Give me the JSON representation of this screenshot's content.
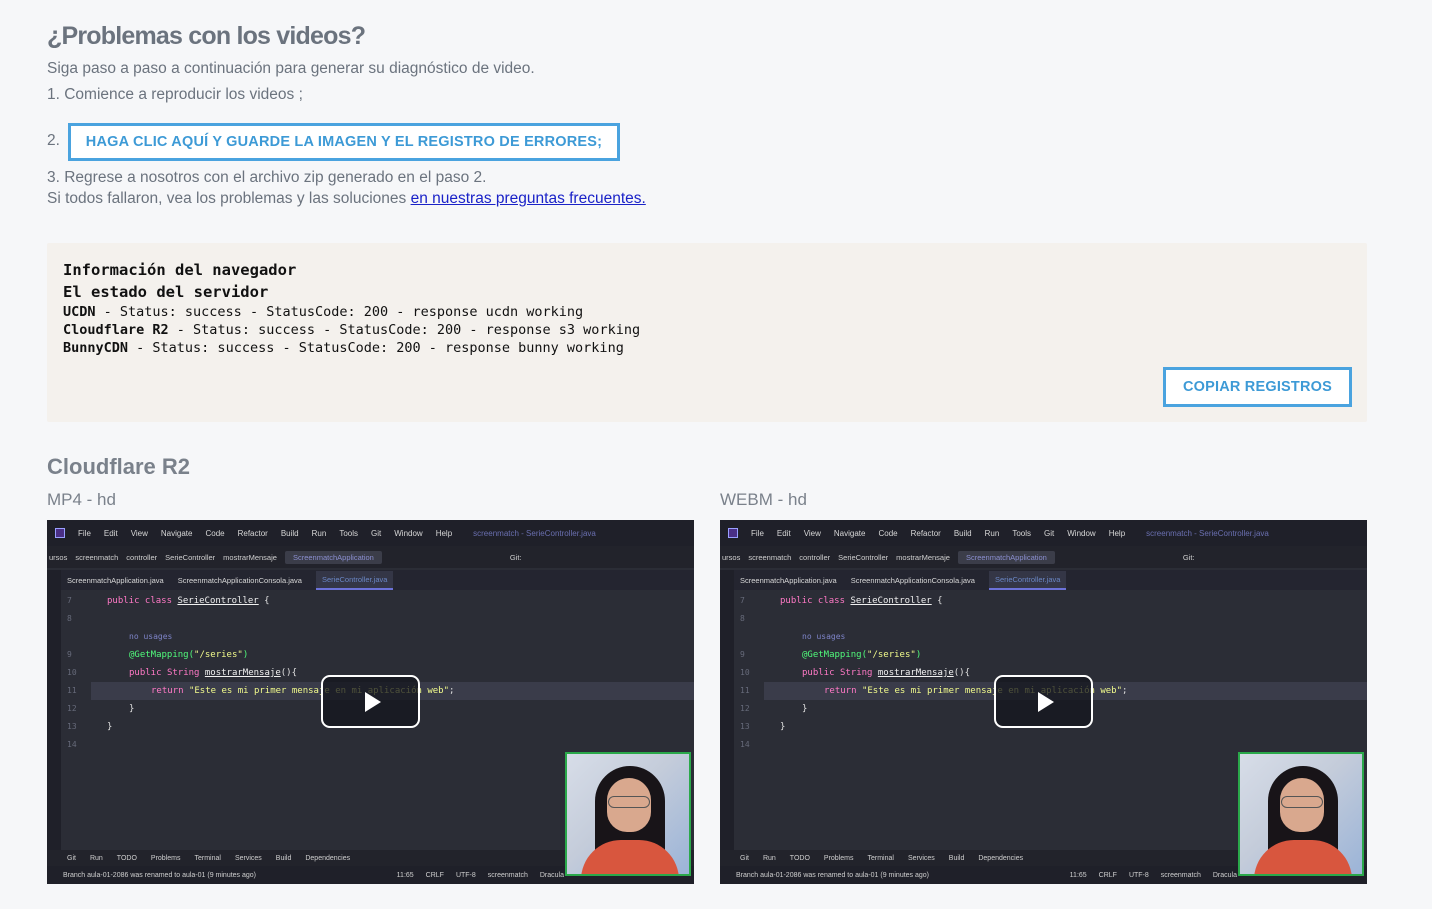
{
  "help": {
    "title": "¿Problemas con los videos?",
    "intro": "Siga paso a paso a continuación para generar su diagnóstico de video.",
    "step1": "1. Comience a reproducir los videos ;",
    "step2_num": "2.",
    "step2_button": "HAGA CLIC AQUÍ Y GUARDE LA IMAGEN Y EL REGISTRO DE ERRORES;",
    "step3": "3. Regrese a nosotros con el archivo zip generado en el paso 2.",
    "fallback_text": "Si todos fallaron, vea los problemas y las soluciones ",
    "fallback_link": "en nuestras preguntas frecuentes."
  },
  "browser_info": {
    "heading": "Información del navegador",
    "server_heading": "El estado del servidor",
    "servers": [
      {
        "name": "UCDN",
        "status": " - Status: success - StatusCode: 200 - response ucdn working"
      },
      {
        "name": "Cloudflare R2",
        "status": " - Status: success - StatusCode: 200 - response s3 working"
      },
      {
        "name": "BunnyCDN",
        "status": " - Status: success - StatusCode: 200 - response bunny working"
      }
    ],
    "copy_button": "COPIAR REGISTROS"
  },
  "section": {
    "title": "Cloudflare R2",
    "videos": [
      {
        "label": "MP4 - hd"
      },
      {
        "label": "WEBM - hd"
      }
    ]
  },
  "ide": {
    "menu": [
      "File",
      "Edit",
      "View",
      "Navigate",
      "Code",
      "Refactor",
      "Build",
      "Run",
      "Tools",
      "Git",
      "Window",
      "Help"
    ],
    "window_title": "screenmatch - SerieController.java",
    "breadcrumb": [
      "ursos",
      "screenmatch",
      "controller",
      "SerieController",
      "mostrarMensaje"
    ],
    "run_config": "ScreenmatchApplication",
    "git_label": "Git:",
    "tabs": [
      "ScreenmatchApplication.java",
      "ScreenmatchApplicationConsola.java",
      "SerieController.java"
    ],
    "line_numbers": [
      "7",
      "8",
      "",
      "9",
      "10",
      "11",
      "12",
      "13",
      "14"
    ],
    "code": {
      "l7a": "public class ",
      "l7b": "SerieController",
      "l7c": " {",
      "hint": "no usages",
      "l9a": "@GetMapping(",
      "l9b": "\"/series\"",
      "l9c": ")",
      "l10a": "public ",
      "l10b": "String ",
      "l10c": "mostrarMensaje",
      "l10d": "(){",
      "l11a": "return ",
      "l11b": "\"Este es mi primer mensaje en mi aplicación web\"",
      "l11c": ";",
      "l12": "}",
      "l13": "}"
    },
    "bottom_tabs": [
      "Git",
      "Run",
      "TODO",
      "Problems",
      "Terminal",
      "Services",
      "Build",
      "Dependencies"
    ],
    "status_left": "Branch aula-01-2086 was renamed to aula-01 (9 minutes ago)",
    "status_right": [
      "11:65",
      "CRLF",
      "UTF-8",
      "screenmatch",
      "Dracula"
    ]
  },
  "colors": {
    "accent": "#4aa3df",
    "link": "#1a22c8",
    "info_bg": "#f4f1ed",
    "ide_bg": "#2b2d36"
  }
}
